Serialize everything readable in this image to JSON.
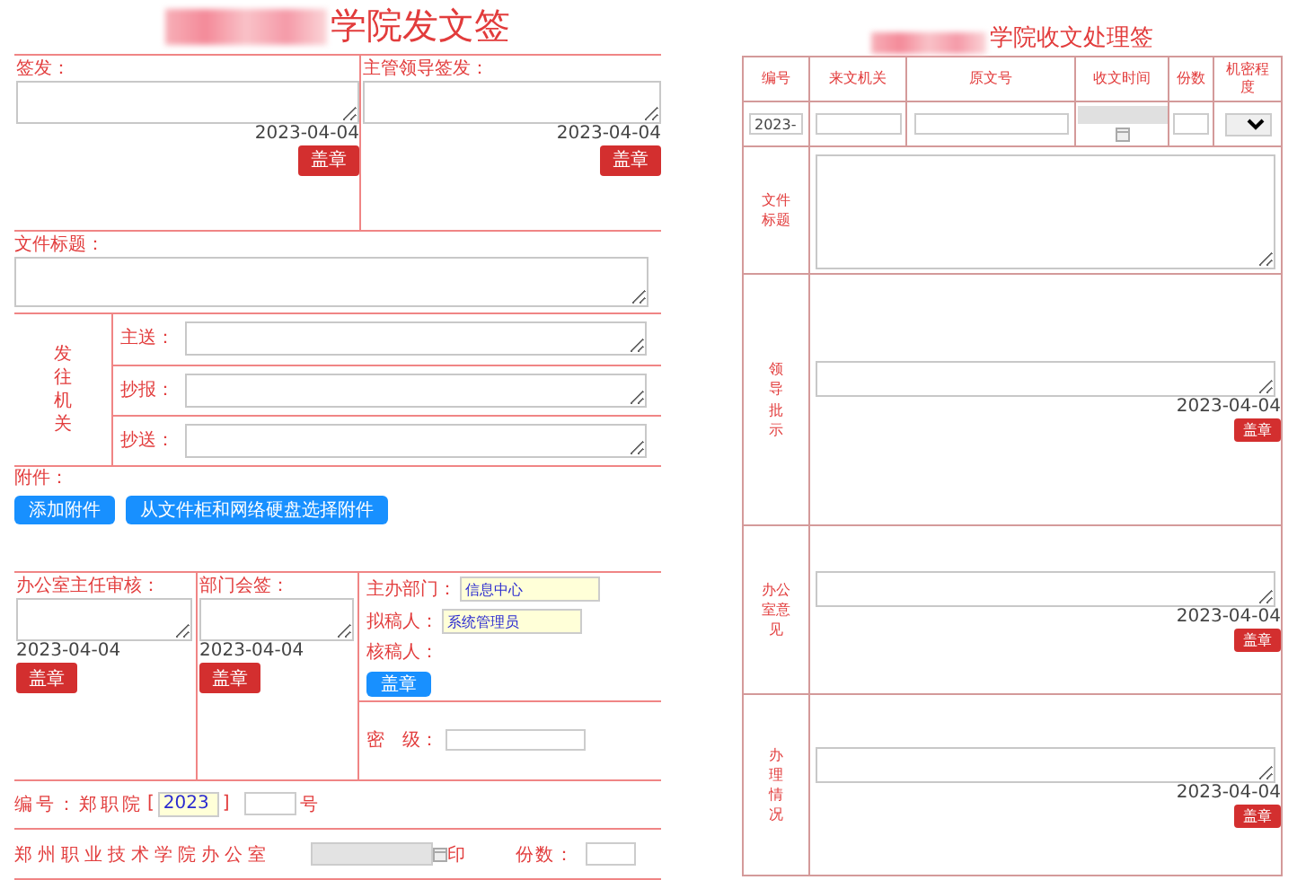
{
  "dispatch": {
    "title": "学院发文签",
    "signoffs": [
      {
        "label": "签发：",
        "date": "2023-04-04",
        "button": "盖章"
      },
      {
        "label": "主管领导签发：",
        "date": "2023-04-04",
        "button": "盖章"
      }
    ],
    "doc_title": {
      "label": "文件标题："
    },
    "recipients": {
      "heading": "发往机关",
      "rows": [
        {
          "label": "主送："
        },
        {
          "label": "抄报："
        },
        {
          "label": "抄送："
        }
      ]
    },
    "attachments": {
      "label": "附件：",
      "buttons": [
        "添加附件",
        "从文件柜和网络硬盘选择附件"
      ]
    },
    "reviews": [
      {
        "label": "办公室主任审核：",
        "date": "2023-04-04",
        "button": "盖章"
      },
      {
        "label": "部门会签：",
        "date": "2023-04-04",
        "button": "盖章"
      }
    ],
    "drafting": {
      "fields": [
        {
          "label": "主办部门：",
          "value": "信息中心"
        },
        {
          "label": "拟稿人：",
          "value": "系统管理员"
        },
        {
          "label": "核稿人："
        }
      ],
      "button": "盖章",
      "secrecy_label": "密　级："
    },
    "number": {
      "prefix": "编号：郑职院",
      "open": "[",
      "year": "2023",
      "close": "]",
      "suffix": "号"
    },
    "footer": {
      "office": "郑州职业技术学院办公室",
      "seal": "印",
      "copies_label": "份数："
    }
  },
  "receipt": {
    "title": "学院收文处理签",
    "columns": [
      "编号",
      "来文机关",
      "原文号",
      "收文时间",
      "份数",
      "机密程度"
    ],
    "number_value": "2023-",
    "sections": [
      {
        "label": "文件标题",
        "kind": "title"
      },
      {
        "label": "领导批示",
        "kind": "signoff",
        "date": "2023-04-04",
        "button": "盖章"
      },
      {
        "label": "办公室意见",
        "kind": "signoff",
        "date": "2023-04-04",
        "button": "盖章"
      },
      {
        "label": "办理情况",
        "kind": "signoff",
        "date": "2023-04-04",
        "button": "盖章"
      }
    ]
  }
}
